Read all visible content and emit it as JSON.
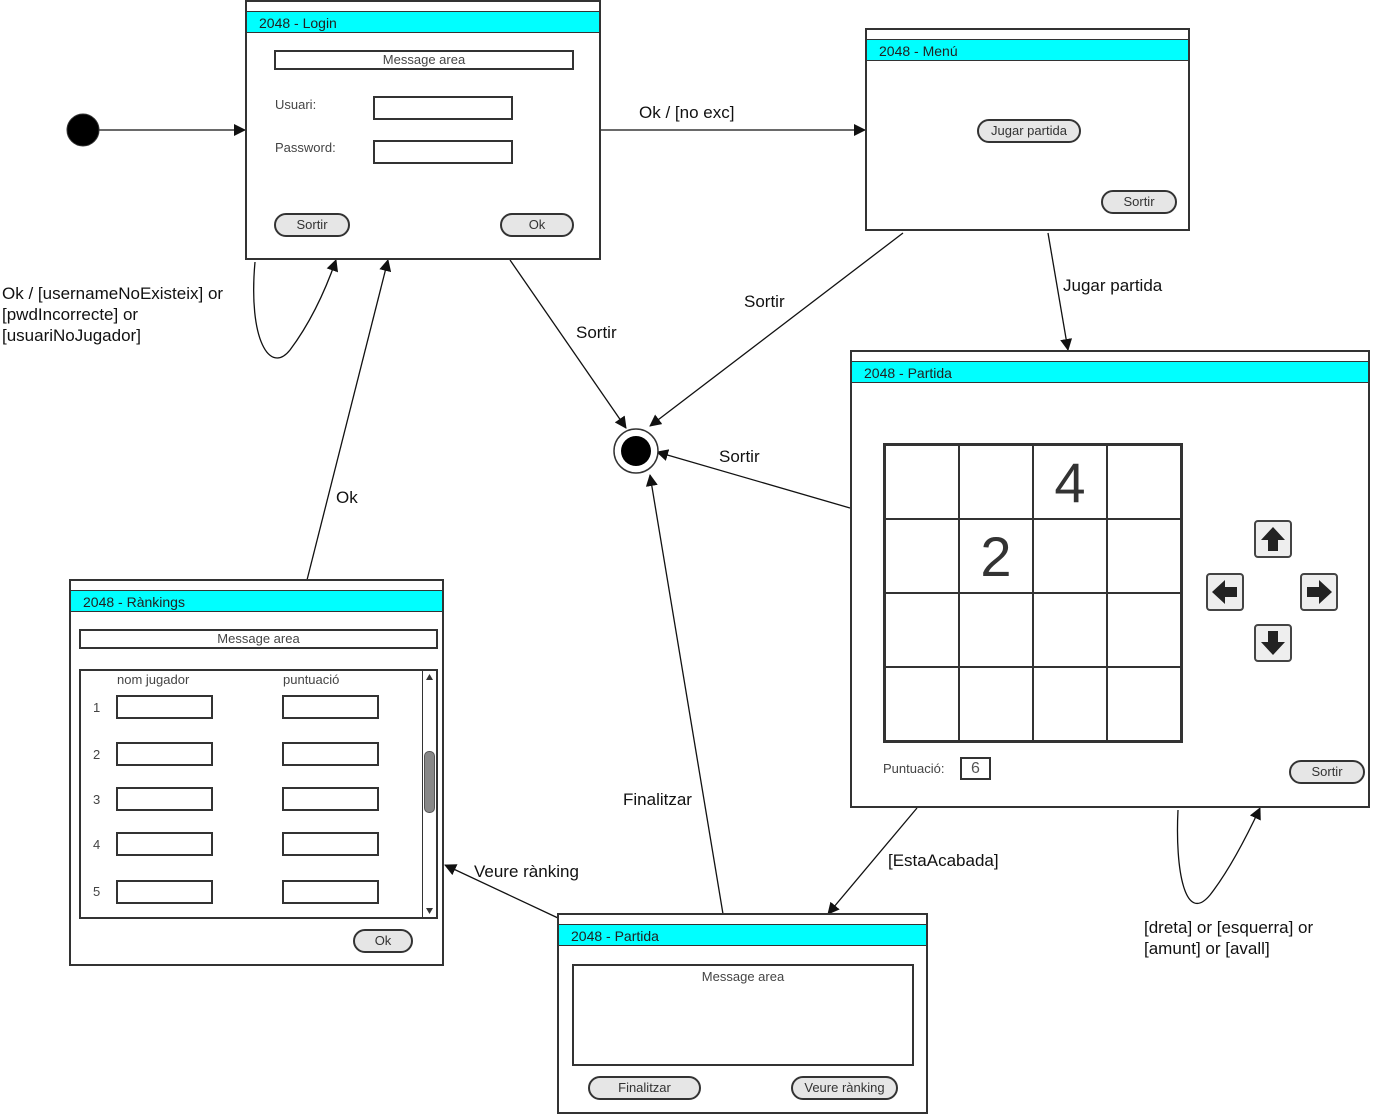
{
  "login": {
    "title": "2048 - Login",
    "message_area": "Message area",
    "usuari_label": "Usuari:",
    "usuari_value": "",
    "password_label": "Password:",
    "password_value": "",
    "sortir_button": "Sortir",
    "ok_button": "Ok"
  },
  "menu": {
    "title": "2048 - Menú",
    "jugar_button": "Jugar partida",
    "sortir_button": "Sortir"
  },
  "partida": {
    "title": "2048 - Partida",
    "board": [
      [
        "",
        "",
        "4",
        ""
      ],
      [
        "",
        "2",
        "",
        ""
      ],
      [
        "",
        "",
        "",
        ""
      ],
      [
        "",
        "",
        "",
        ""
      ]
    ],
    "score_label": "Puntuació:",
    "score_value": "6",
    "sortir_button": "Sortir",
    "controls": [
      "arrow-up-icon",
      "arrow-left-icon",
      "arrow-right-icon",
      "arrow-down-icon"
    ]
  },
  "rankings": {
    "title": "2048 - Rànkings",
    "message_area": "Message area",
    "col_player": "nom jugador",
    "col_score": "puntuació",
    "rows": [
      "1",
      "2",
      "3",
      "4",
      "5"
    ],
    "ok_button": "Ok"
  },
  "fi_partida": {
    "title": "2048 - Partida",
    "message_area": "Message area",
    "finalitzar_button": "Finalitzar",
    "ranking_button": "Veure rànking"
  },
  "transitions": {
    "login_to_menu": "Ok / [no exc]",
    "login_self_line1": "Ok / [usernameNoExisteix] or",
    "login_self_line2": "[pwdIncorrecte] or",
    "login_self_line3": "[usuariNoJugador]",
    "login_to_final": "Sortir",
    "menu_to_final": "Sortir",
    "menu_to_partida": "Jugar partida",
    "partida_to_final": "Sortir",
    "partida_self_line1": "[dreta] or [esquerra] or",
    "partida_self_line2": "[amunt] or [avall]",
    "partida_to_fi": "[EstaAcabada]",
    "fi_to_final": "Finalitzar",
    "fi_to_rankings": "Veure rànking",
    "rankings_to_login": "Ok"
  },
  "colors": {
    "title_bar": "#00ffff",
    "button_fill": "#e6e6e6",
    "line": "#111111"
  }
}
